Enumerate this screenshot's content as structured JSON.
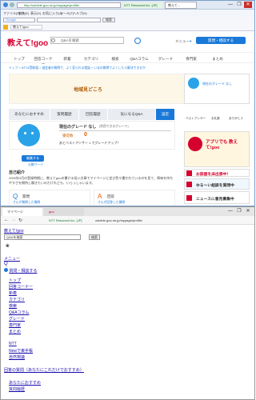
{
  "ie": {
    "url": "http://oshiete.goo.ne.jp/mypage/profile/",
    "site_badge": "NTT Resonant Inc. [JP]",
    "tab_title": "教えて!goo",
    "tab2_title": "教えて...",
    "menu": [
      "ファイル(F)",
      "編集(E)",
      "表示(V)",
      "お気に入り(A)",
      "ツール(T)",
      "ヘルプ(H)"
    ],
    "search_engine": "Google",
    "search_btn": "検索",
    "window_controls": [
      "—",
      "❐",
      "✕"
    ]
  },
  "page": {
    "logo": "教えて!goo",
    "search_placeholder": "Q&Aを検索",
    "menu_label": "メニュー",
    "ask_button": "質問・相談する",
    "nav": [
      "トップ",
      "回答コーナー",
      "新着",
      "カテゴリ",
      "検索",
      "Q&Aコラム",
      "グレード",
      "専門家",
      "まとめ"
    ],
    "breadcrumb": [
      "トップ",
      "NTT&受取組",
      "退会者の質問で、よく見られる相談",
      "いまの質問でよくしたら解決できるか"
    ],
    "banner": "地域見どころ",
    "tabs": [
      "あなたにおすすめ",
      "質問履歴",
      "回答履歴",
      "気になるQ&A",
      "設定"
    ],
    "profile_edit": "編集する",
    "profile_link": "公開ページ",
    "grade_title": "現在のグレード なし",
    "grade_sub": "(利用できるグレード)",
    "points_label": "獲得数",
    "points_value": "0",
    "best_answer": "あとベストアンサー 1 でグレードアップ！",
    "self_intro_title": "自己紹介",
    "self_intro": "2000年3月の登録時期に、教えてgooの書ける長い文章でマイページに並び色々書かれているのを見て、興味を持ちやすさを期待し開きたいのだけれども、いらっしゃいます。",
    "q_label": "質問",
    "a_label": "回答",
    "q_count": "0",
    "a_count": "0",
    "q_more": "さんが質問した質問",
    "a_more": "さんが回答した質問",
    "side_user": "現在のグレード なし",
    "side_stats": [
      "ベストアンサー",
      "お礼数",
      "ありがとう"
    ],
    "ad1": "アプリでも 教えて!goo",
    "ad2_caption": "お部屋を床出張中！",
    "ad3": "ゆる〜い組談を質問中",
    "ad4": "ニュースに意見募集中"
  },
  "edge": {
    "tab_title": "マイページ",
    "tab2": "goo",
    "url": "oshiete.goo.ne.jp/mypage/profile/",
    "site_badge": "NTT Resonant Inc. [JP]",
    "lines": {
      "logo": "教えて!goo",
      "search_value": "Q&Aを検索",
      "search_btn": "検索",
      "menu": "メニュー",
      "ask": "質問・相談する",
      "nav": [
        "トップ",
        "回答コーナー",
        "新着",
        "カテゴリ",
        "検索",
        "Q&Aコラム",
        "グレード",
        "専門家",
        "まとめ"
      ],
      "sub": [
        "NTT",
        "Newで東手帳",
        "自然規議"
      ],
      "footer1": "回答の質問（あなたにこれだけでおすすめ）",
      "footer2": "あなたにおすすめ",
      "footer3": "質問履歴"
    }
  }
}
